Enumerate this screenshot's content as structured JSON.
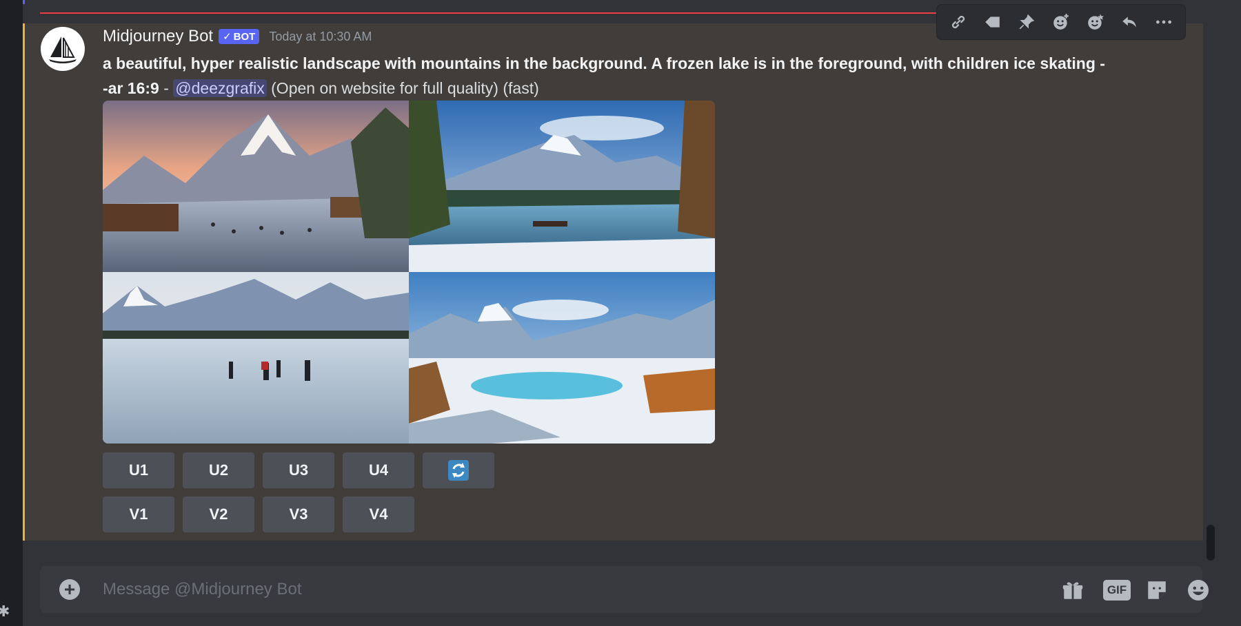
{
  "message": {
    "author": "Midjourney Bot",
    "bot_tag": "BOT",
    "bot_check": "✓",
    "timestamp": "Today at 10:30 AM",
    "prompt_line1": "a beautiful, hyper realistic landscape with mountains in the background. A frozen lake is in the foreground, with children ice skating -",
    "prompt_line2": "-ar 16:9",
    "separator": " - ",
    "mention": "@deezgrafix",
    "suffix": " (Open on website for full quality) (fast)"
  },
  "images": [
    {
      "name": "image-1"
    },
    {
      "name": "image-2"
    },
    {
      "name": "image-3"
    },
    {
      "name": "image-4"
    }
  ],
  "upscale_buttons": [
    "U1",
    "U2",
    "U3",
    "U4"
  ],
  "variation_buttons": [
    "V1",
    "V2",
    "V3",
    "V4"
  ],
  "reroll_icon": "refresh-icon",
  "toolbar_icons": [
    "link-icon",
    "tag-icon",
    "pin-icon",
    "add-reaction-icon",
    "super-reaction-icon",
    "reply-icon",
    "more-icon"
  ],
  "composer": {
    "placeholder": "Message @Midjourney Bot",
    "gif_label": "GIF"
  },
  "colors": {
    "accent": "#5865f2",
    "mention_highlight": "#f0b232",
    "new_message_line": "#f23f43",
    "background": "#313338",
    "message_bg": "#403d3a",
    "button_bg": "#4e5058"
  }
}
